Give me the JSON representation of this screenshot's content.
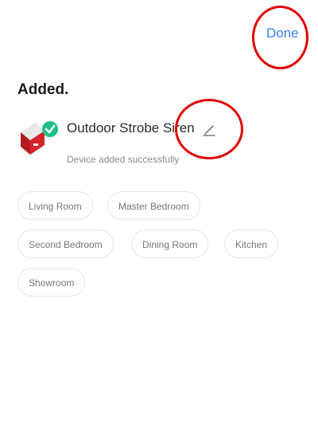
{
  "header": {
    "done_label": "Done"
  },
  "status_title": "Added.",
  "device": {
    "name": "Outdoor Strobe Siren",
    "status": "Device added successfully",
    "icon": "siren-device-icon",
    "badge_icon": "check-circle-icon",
    "edit_icon": "pencil-icon"
  },
  "rooms": [
    "Living Room",
    "Master Bedroom",
    "Second Bedroom",
    "Dining Room",
    "Kitchen",
    "Showroom"
  ],
  "colors": {
    "accent": "#3d7fe8",
    "success": "#1fbf87",
    "device_red": "#d4252b",
    "annotation": "#e00000"
  }
}
